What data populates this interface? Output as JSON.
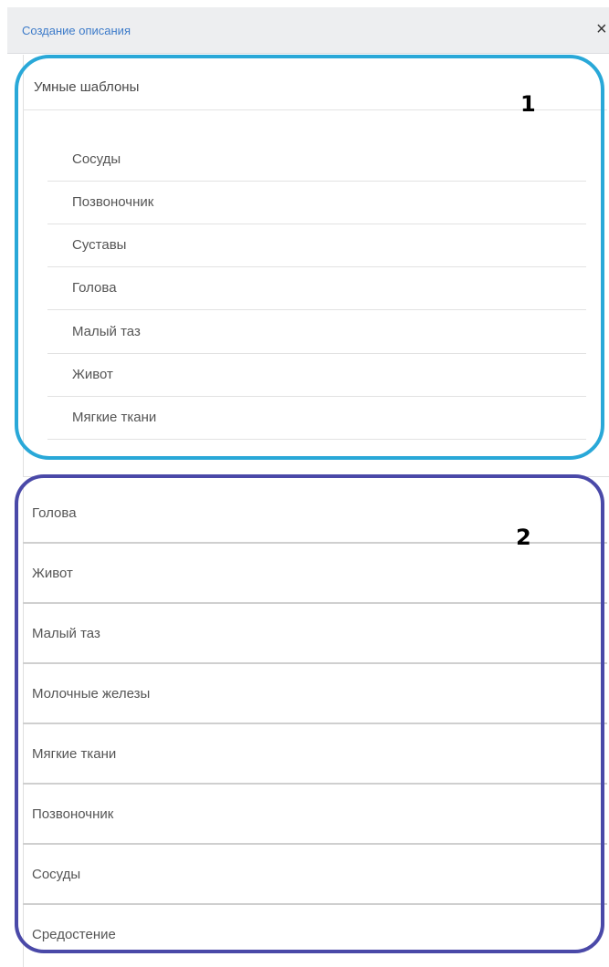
{
  "dialog": {
    "title": "Создание описания",
    "close_icon": "×"
  },
  "smart_templates": {
    "title": "Умные шаблоны",
    "items": [
      {
        "label": "Сосуды"
      },
      {
        "label": "Позвоночник"
      },
      {
        "label": "Суставы"
      },
      {
        "label": "Голова"
      },
      {
        "label": "Малый таз"
      },
      {
        "label": "Живот"
      },
      {
        "label": "Мягкие ткани"
      }
    ]
  },
  "templates": {
    "items": [
      {
        "label": "Голова"
      },
      {
        "label": "Живот"
      },
      {
        "label": "Малый таз"
      },
      {
        "label": "Молочные железы"
      },
      {
        "label": "Мягкие ткани"
      },
      {
        "label": "Позвоночник"
      },
      {
        "label": "Сосуды"
      },
      {
        "label": "Средостение"
      }
    ]
  },
  "annotations": {
    "first": "1",
    "second": "2",
    "first_color": "#29a8d8",
    "second_color": "#4a49a8"
  }
}
